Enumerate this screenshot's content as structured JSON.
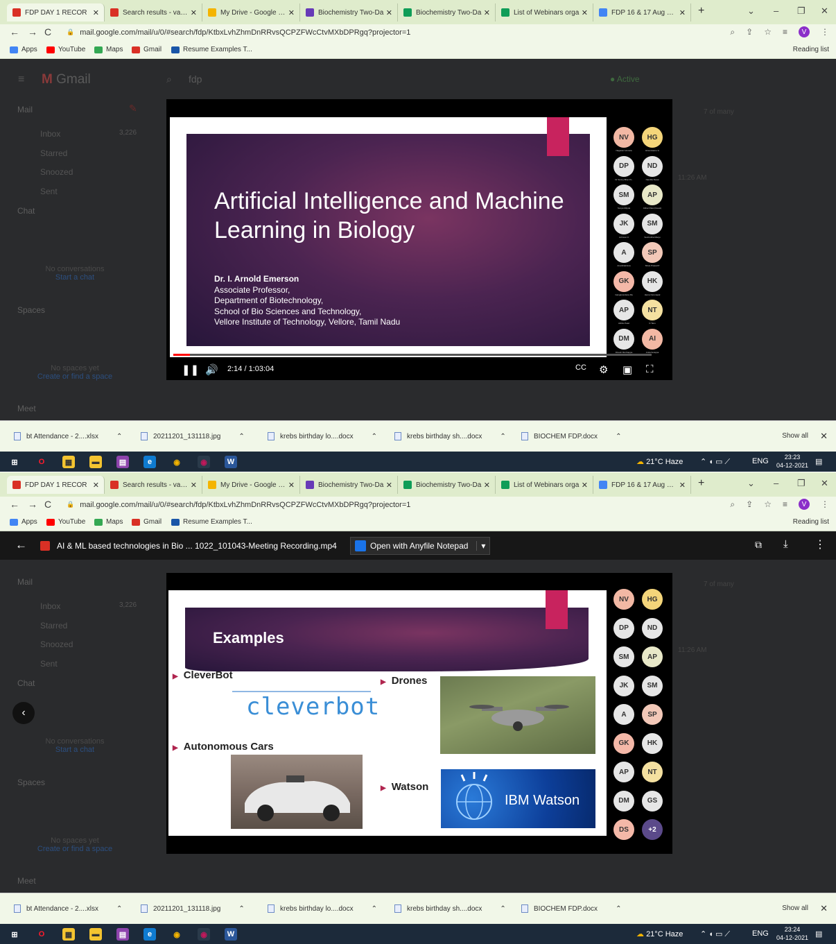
{
  "tabs": [
    {
      "title": "FDP DAY 1 RECOR",
      "favicon_color": "#d93025",
      "active": true
    },
    {
      "title": "Search results - vani.b",
      "favicon_color": "#d93025"
    },
    {
      "title": "My Drive - Google Dri",
      "favicon_color": "#f4b400"
    },
    {
      "title": "Biochemistry Two-Da",
      "favicon_color": "#673ab7"
    },
    {
      "title": "Biochemistry Two-Da",
      "favicon_color": "#0f9d58"
    },
    {
      "title": "List of Webinars orga",
      "favicon_color": "#0f9d58"
    },
    {
      "title": "FDP 16 & 17 Aug 202",
      "favicon_color": "#4285f4"
    }
  ],
  "url": "mail.google.com/mail/u/0/#search/fdp/KtbxLvhZhmDnRRvsQCPZFWcCtvMXbDPRgq?projector=1",
  "profile_initial": "V",
  "bookmarks": [
    {
      "label": "Apps",
      "color": "#4285f4"
    },
    {
      "label": "YouTube",
      "color": "#ff0000"
    },
    {
      "label": "Maps",
      "color": "#34a853"
    },
    {
      "label": "Gmail",
      "color": "#d93025"
    },
    {
      "label": "Resume Examples T...",
      "color": "#1a56a8"
    }
  ],
  "reading_list": "Reading list",
  "gmail": {
    "logo": "Gmail",
    "search": "fdp",
    "status": "Active",
    "mail": "Mail",
    "inbox": "Inbox",
    "inbox_count": "3,226",
    "starred": "Starred",
    "snoozed": "Snoozed",
    "sent": "Sent",
    "chat": "Chat",
    "no_conversations": "No conversations",
    "start_chat": "Start a chat",
    "spaces": "Spaces",
    "no_spaces": "No spaces yet",
    "create_space": "Create or find a space",
    "meet": "Meet",
    "pager": "7 of many",
    "time": "11:26 AM"
  },
  "shot1": {
    "slide_title": "Artificial Intelligence and Machine Learning in Biology",
    "author_lines": [
      "Dr. I. Arnold Emerson",
      "Associate Professor,",
      "Department of Biotechnology,",
      "School of Bio Sciences and Technology,",
      "Vellore Institute of Technology, Vellore, Tamil Nadu"
    ],
    "timecode": "2:14 / 1:03:04",
    "progress_fraction": 0.035,
    "participants": [
      {
        "initials": "NV",
        "color": "#f2b8a4",
        "name": "Nagarani Vemula"
      },
      {
        "initials": "HG",
        "color": "#f4d57a",
        "name": "Hinumisame G"
      },
      {
        "initials": "DP",
        "color": "#e6e6e6",
        "name": "Dr Sunny Bhat P.L."
      },
      {
        "initials": "ND",
        "color": "#e6e6e6",
        "name": "Nandita Desai"
      },
      {
        "initials": "SM",
        "color": "#e6e6e6",
        "name": "Sonya Mirjula"
      },
      {
        "initials": "AP",
        "color": "#e8e8c8",
        "name": "Abhar Patel (Guest)"
      },
      {
        "initials": "JK",
        "color": "#e6e6e6",
        "name": "Johnson K"
      },
      {
        "initials": "SM",
        "color": "#e6e6e6",
        "name": "Sushmitha Manju"
      },
      {
        "initials": "A",
        "color": "#e6e6e6",
        "name": "Ananthakrisna"
      },
      {
        "initials": "SP",
        "color": "#f2c8b8",
        "name": "Shiva Prasad P"
      },
      {
        "initials": "GK",
        "color": "#f4b8a8",
        "name": "Ganganandana Ra"
      },
      {
        "initials": "HK",
        "color": "#e6e6e6",
        "name": "Hema Karunapal"
      },
      {
        "initials": "AP",
        "color": "#e6e6e6",
        "name": "Abhilu Patel"
      },
      {
        "initials": "NT",
        "color": "#f4e0a0",
        "name": "N Tanu"
      },
      {
        "initials": "DM",
        "color": "#e6e6e6",
        "name": "Dinesh Murthappa"
      },
      {
        "initials": "AI",
        "color": "#f2b8a4",
        "name": "Anita Ilerappa"
      }
    ]
  },
  "shot2": {
    "file_title": "AI & ML based technologies in Bio ... 1022_101043-Meeting Recording.mp4",
    "open_with": "Open with Anyfile Notepad",
    "slide_title": "Examples",
    "items": [
      "CleverBot",
      "Drones",
      "Autonomous Cars",
      "Watson"
    ],
    "cleverbot_logo": "cleverbot",
    "watson_logo": "IBM Watson",
    "participants": [
      {
        "initials": "NV",
        "color": "#f2b8a4"
      },
      {
        "initials": "HG",
        "color": "#f4d57a"
      },
      {
        "initials": "DP",
        "color": "#e6e6e6"
      },
      {
        "initials": "ND",
        "color": "#e6e6e6"
      },
      {
        "initials": "SM",
        "color": "#e6e6e6"
      },
      {
        "initials": "AP",
        "color": "#e8e8c8"
      },
      {
        "initials": "JK",
        "color": "#e6e6e6"
      },
      {
        "initials": "SM",
        "color": "#e6e6e6"
      },
      {
        "initials": "A",
        "color": "#e6e6e6"
      },
      {
        "initials": "SP",
        "color": "#f2c8b8"
      },
      {
        "initials": "GK",
        "color": "#f4b8a8"
      },
      {
        "initials": "HK",
        "color": "#e6e6e6"
      },
      {
        "initials": "AP",
        "color": "#e6e6e6"
      },
      {
        "initials": "NT",
        "color": "#f4e0a0"
      },
      {
        "initials": "DM",
        "color": "#e6e6e6"
      },
      {
        "initials": "GS",
        "color": "#e6e6e6"
      },
      {
        "initials": "DS",
        "color": "#f4b8a8"
      },
      {
        "initials": "+2",
        "color": "#5b4a8a"
      }
    ]
  },
  "downloads": [
    {
      "name": "bt Attendance - 2....xlsx"
    },
    {
      "name": "20211201_131118.jpg"
    },
    {
      "name": "krebs birthday lo....docx"
    },
    {
      "name": "krebs birthday sh....docx"
    },
    {
      "name": "BIOCHEM FDP.docx"
    }
  ],
  "show_all": "Show all",
  "taskbar": {
    "weather": "21°C Haze",
    "lang": "ENG",
    "time1": "23:23",
    "time2": "23:24",
    "date": "04-12-2021"
  }
}
